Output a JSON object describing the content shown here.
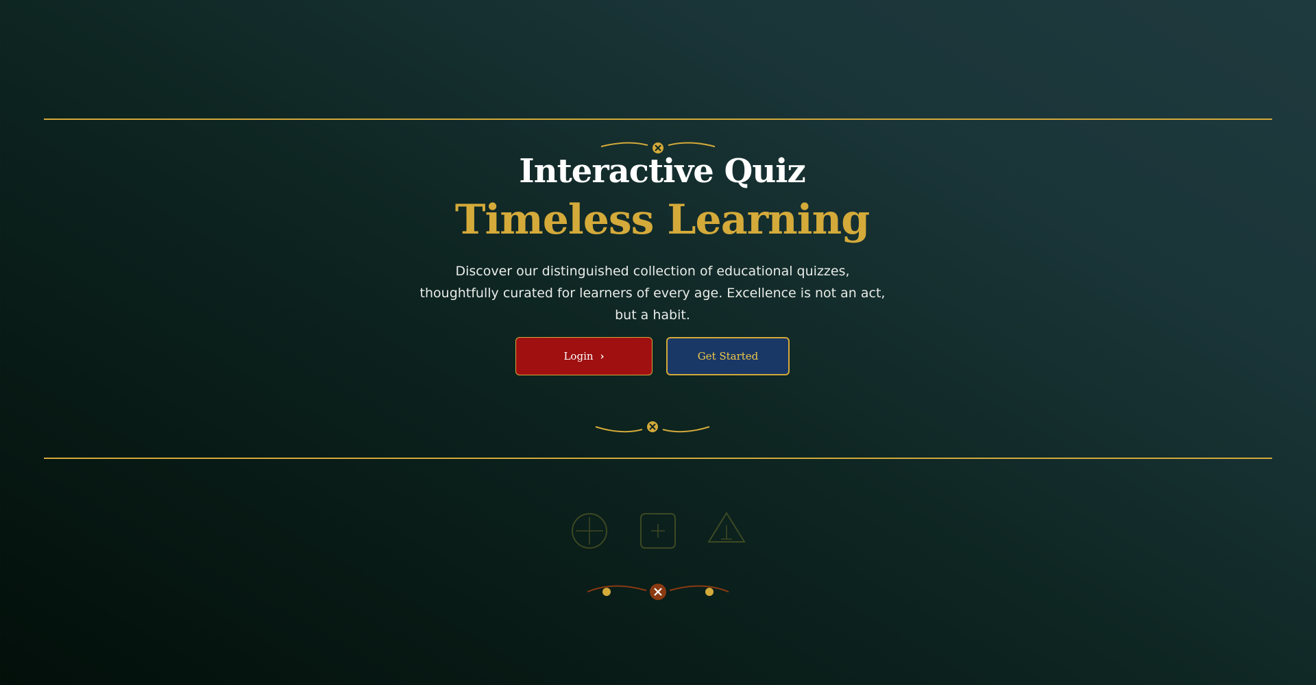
{
  "hero": {
    "title": "Interactive Quiz",
    "subtitle": "Timeless Learning",
    "description": "Discover our distinguished collection of educational quizzes, thoughtfully curated for learners of every age. Excellence is not an act, but a habit."
  },
  "actions": {
    "login_label": "Login",
    "login_icon": "chevron-right-icon",
    "get_started_label": "Get Started"
  },
  "decorations": {
    "shapes": [
      "circle-plus-icon",
      "square-plus-icon",
      "triangle-icon"
    ]
  },
  "colors": {
    "gold": "#d4aa3a",
    "login_red": "#a01010",
    "get_started_navy": "#1a3866",
    "bottom_accent": "#8b3a12"
  }
}
